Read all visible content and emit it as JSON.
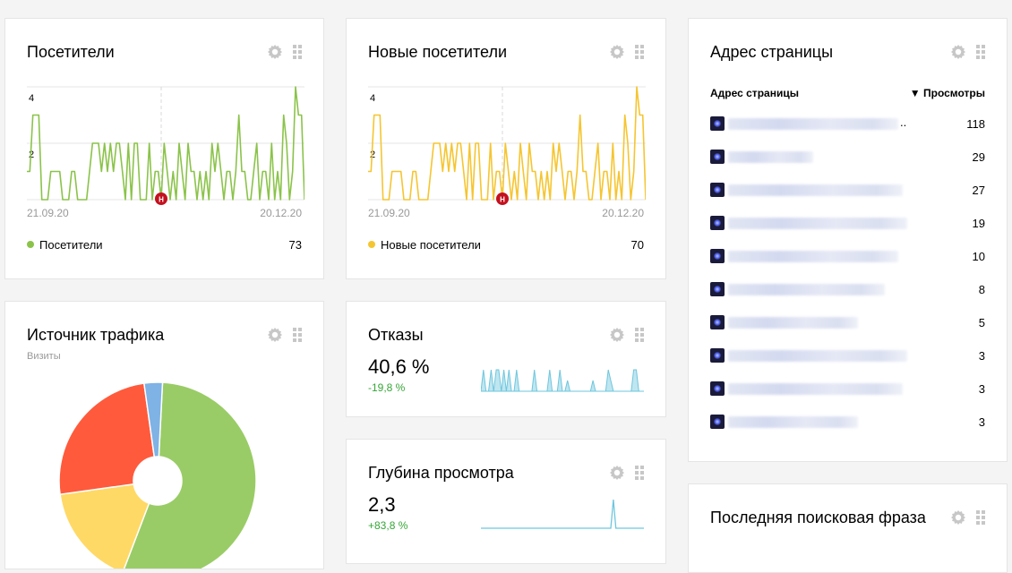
{
  "colors": {
    "visitors_line": "#8bc34a",
    "new_visitors_line": "#f5c531",
    "bounce_area": "#6ec6dd",
    "marker": "#c4101e",
    "pie_green": "#99cc66",
    "pie_yellow": "#ffd966",
    "pie_red": "#ff5a3c",
    "pie_blue": "#7fb2e5",
    "delta_positive": "#36a637"
  },
  "visitors": {
    "title": "Посетители",
    "y_ticks": [
      "4",
      "2"
    ],
    "x_start": "21.09.20",
    "x_end": "20.12.20",
    "marker_label": "Н",
    "legend_label": "Посетители",
    "total": "73",
    "series": [
      1,
      1,
      3,
      3,
      3,
      0,
      0,
      0,
      1,
      1,
      1,
      1,
      0,
      0,
      0,
      1,
      1,
      0,
      0,
      0,
      0,
      1,
      2,
      2,
      2,
      1,
      2,
      1,
      2,
      1,
      2,
      2,
      1,
      0,
      2,
      0,
      2,
      2,
      0,
      0,
      0,
      2,
      0,
      1,
      1,
      0,
      2,
      1,
      0,
      1,
      0,
      2,
      1,
      0,
      2,
      1,
      1,
      0,
      1,
      0,
      1,
      0,
      2,
      1,
      2,
      1,
      0,
      1,
      1,
      0,
      1,
      3,
      1,
      1,
      0,
      0,
      1,
      2,
      0,
      1,
      1,
      0,
      2,
      0,
      1,
      0,
      3,
      2,
      0,
      1,
      4,
      3,
      3,
      0
    ]
  },
  "new_visitors": {
    "title": "Новые посетители",
    "y_ticks": [
      "4",
      "2"
    ],
    "x_start": "21.09.20",
    "x_end": "20.12.20",
    "marker_label": "Н",
    "legend_label": "Новые посетители",
    "total": "70",
    "series": [
      1,
      1,
      3,
      3,
      3,
      0,
      0,
      0,
      1,
      1,
      1,
      1,
      0,
      0,
      0,
      1,
      1,
      0,
      0,
      0,
      0,
      1,
      2,
      2,
      2,
      1,
      2,
      1,
      2,
      1,
      2,
      2,
      1,
      0,
      2,
      0,
      2,
      2,
      0,
      0,
      0,
      2,
      0,
      1,
      1,
      0,
      2,
      1,
      0,
      1,
      0,
      2,
      1,
      0,
      2,
      1,
      1,
      0,
      1,
      0,
      1,
      0,
      2,
      1,
      2,
      1,
      0,
      1,
      1,
      0,
      1,
      3,
      1,
      1,
      0,
      0,
      1,
      2,
      0,
      1,
      1,
      0,
      2,
      0,
      1,
      0,
      3,
      2,
      0,
      1,
      4,
      3,
      3,
      0
    ]
  },
  "traffic": {
    "title": "Источник трафика",
    "subtitle": "Визиты",
    "chart_data": {
      "type": "pie",
      "slices": [
        {
          "share": 0.55,
          "color": "#99cc66"
        },
        {
          "share": 0.17,
          "color": "#ffd966"
        },
        {
          "share": 0.25,
          "color": "#ff5a3c"
        },
        {
          "share": 0.03,
          "color": "#7fb2e5"
        }
      ]
    }
  },
  "bounces": {
    "title": "Отказы",
    "value": "40,6 %",
    "delta": "-19,8 %",
    "spark": [
      0,
      2,
      0,
      0,
      2,
      0,
      2,
      2,
      0,
      2,
      0,
      2,
      0,
      0,
      2,
      0,
      0,
      0,
      0,
      0,
      0,
      2,
      0,
      0,
      0,
      0,
      0,
      2,
      0,
      0,
      0,
      2,
      0,
      0,
      1,
      0,
      0,
      0,
      0,
      0,
      0,
      0,
      0,
      0,
      1,
      0,
      0,
      0,
      0,
      0,
      2,
      1,
      0,
      0,
      0,
      0,
      0,
      0,
      0,
      0,
      2,
      2,
      0,
      0,
      0
    ]
  },
  "depth": {
    "title": "Глубина просмотра",
    "value": "2,3",
    "delta": "+83,8 %",
    "spark": [
      0,
      0,
      0,
      0,
      0,
      0,
      0,
      0,
      0,
      0,
      0,
      0,
      0,
      0,
      0,
      0,
      0,
      0,
      0,
      0,
      0,
      0,
      0,
      0,
      0,
      0,
      0,
      0,
      0,
      0,
      0,
      0,
      0,
      0,
      0,
      0,
      0,
      0,
      0,
      0,
      0,
      0,
      0,
      0,
      0,
      0,
      0,
      0,
      0,
      0,
      0,
      0,
      6,
      0,
      0,
      0,
      0,
      0,
      0,
      0,
      0,
      0,
      0,
      0,
      0
    ]
  },
  "pages": {
    "title": "Адрес страницы",
    "col_page": "Адрес страницы",
    "col_views": "▼ Просмотры",
    "rows": [
      {
        "views": "118",
        "trail": ".."
      },
      {
        "views": "29",
        "trail": ""
      },
      {
        "views": "27",
        "trail": ""
      },
      {
        "views": "19",
        "trail": ""
      },
      {
        "views": "10",
        "trail": ""
      },
      {
        "views": "8",
        "trail": ""
      },
      {
        "views": "5",
        "trail": ""
      },
      {
        "views": "3",
        "trail": ""
      },
      {
        "views": "3",
        "trail": ""
      },
      {
        "views": "3",
        "trail": ""
      }
    ]
  },
  "search": {
    "title": "Последняя поисковая фраза"
  },
  "icons": [
    "gear-icon",
    "drag-handle-icon",
    "favicon-icon"
  ]
}
